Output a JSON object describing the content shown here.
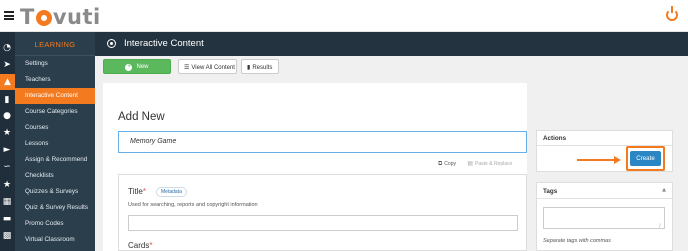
{
  "app": {
    "logo_text_prefix": "T",
    "logo_text_suffix": "vuti"
  },
  "sidebar": {
    "header": "LEARNING",
    "items": [
      {
        "label": "Settings",
        "icon": "speedometer-icon"
      },
      {
        "label": "Teachers",
        "icon": "rocket-icon"
      },
      {
        "label": "Interactive Content",
        "icon": "graduation-cap-icon",
        "active": true
      },
      {
        "label": "Course Categories",
        "icon": "bar-chart-icon"
      },
      {
        "label": "Courses",
        "icon": "users-icon"
      },
      {
        "label": "Lessons",
        "icon": "trophy-icon"
      },
      {
        "label": "Assign & Recommend",
        "icon": "megaphone-icon"
      },
      {
        "label": "Checklists",
        "icon": "rss-icon"
      },
      {
        "label": "Quizzes & Surveys",
        "icon": "star-icon"
      },
      {
        "label": "Quiz & Survey Results",
        "icon": "table-icon"
      },
      {
        "label": "Promo Codes",
        "icon": "credit-card-icon"
      },
      {
        "label": "Virtual Classroom",
        "icon": "org-chart-icon"
      }
    ]
  },
  "header": {
    "title": "Interactive Content"
  },
  "toolbar": {
    "new_label": "New",
    "view_all_label": "View All Content",
    "results_label": "Results"
  },
  "main": {
    "heading": "Add New",
    "content_title_value": "Memory Game",
    "copy_label": "Copy",
    "paste_label": "Paste & Replace",
    "title_field": {
      "label": "Title",
      "required_mark": "*",
      "metadata_label": "Metadata",
      "help": "Used for searching, reports and copyright information"
    },
    "cards_field": {
      "label": "Cards",
      "required_mark": "*"
    }
  },
  "actions": {
    "heading": "Actions",
    "create_label": "Create"
  },
  "tags": {
    "heading": "Tags",
    "hint": "Separate tags with commas"
  },
  "colors": {
    "accent": "#f47a20",
    "sidebar": "#2b3e4c",
    "header": "#233340",
    "primary": "#2a87c4",
    "success": "#5cb85c"
  }
}
